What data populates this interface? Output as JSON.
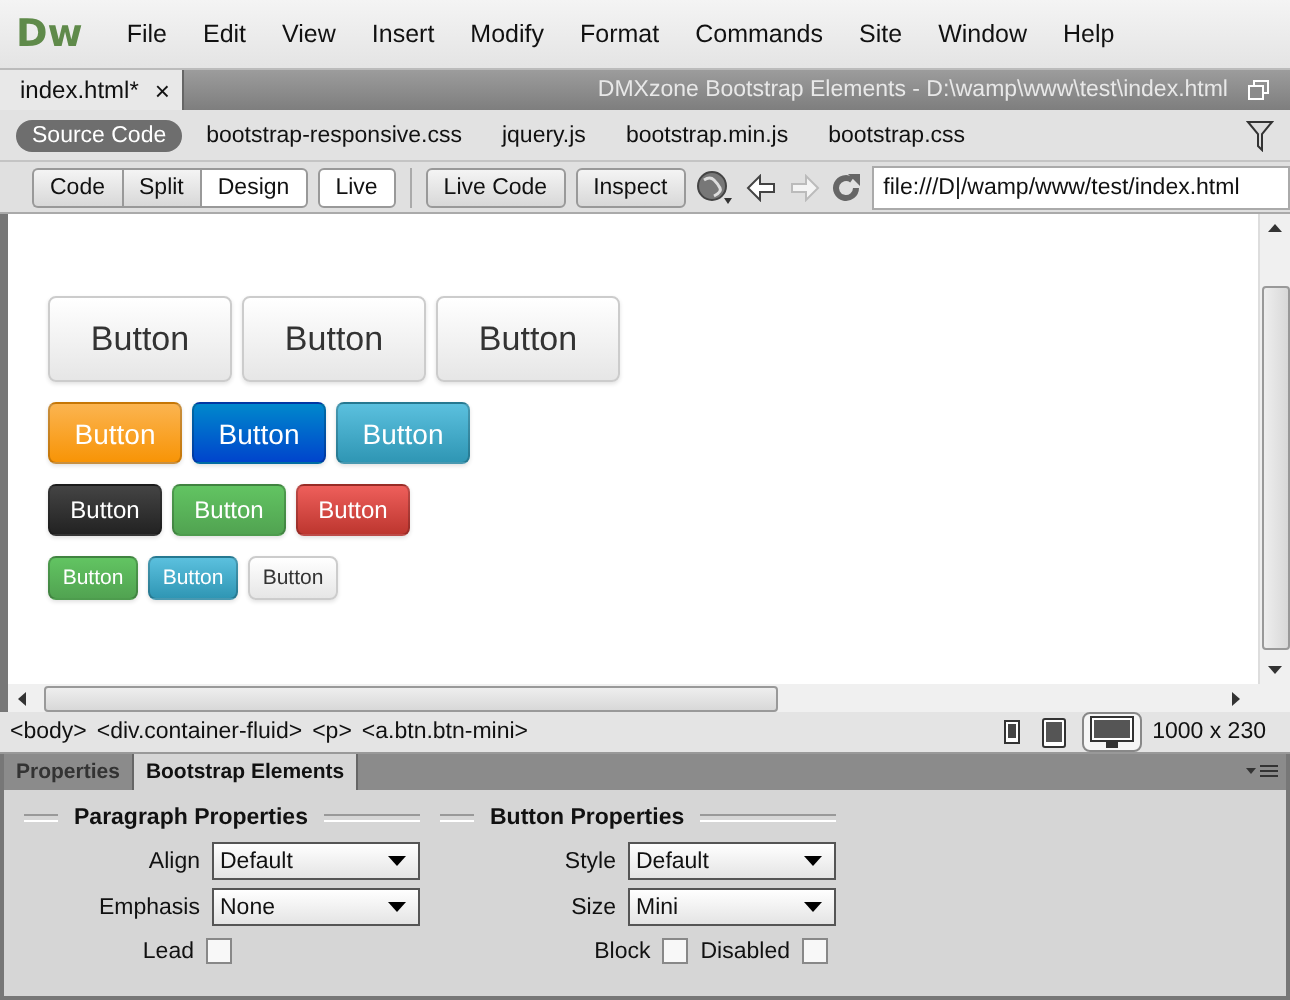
{
  "app": {
    "logo": "Dw"
  },
  "menu": [
    "File",
    "Edit",
    "View",
    "Insert",
    "Modify",
    "Format",
    "Commands",
    "Site",
    "Window",
    "Help"
  ],
  "document_tab": {
    "label": "index.html*",
    "close": "×"
  },
  "window_title": "DMXzone Bootstrap Elements - D:\\wamp\\www\\test\\index.html",
  "related_files": [
    {
      "label": "Source Code",
      "selected": true
    },
    {
      "label": "bootstrap-responsive.css",
      "selected": false
    },
    {
      "label": "jquery.js",
      "selected": false
    },
    {
      "label": "bootstrap.min.js",
      "selected": false
    },
    {
      "label": "bootstrap.css",
      "selected": false
    }
  ],
  "view_modes": [
    {
      "label": "Code",
      "selected": false
    },
    {
      "label": "Split",
      "selected": false
    },
    {
      "label": "Design",
      "selected": true
    }
  ],
  "live_button": "Live",
  "toolbar_buttons": [
    "Live Code",
    "Inspect"
  ],
  "address": "file:///D|/wamp/www/test/index.html",
  "button_rows": [
    {
      "kind": "large",
      "buttons": [
        {
          "label": "Button",
          "kind": "default"
        },
        {
          "label": "Button",
          "kind": "default"
        },
        {
          "label": "Button",
          "kind": "default"
        }
      ]
    },
    {
      "kind": "normal",
      "buttons": [
        {
          "label": "Button",
          "kind": "warning"
        },
        {
          "label": "Button",
          "kind": "primary"
        },
        {
          "label": "Button",
          "kind": "info"
        }
      ]
    },
    {
      "kind": "small",
      "buttons": [
        {
          "label": "Button",
          "kind": "inverse"
        },
        {
          "label": "Button",
          "kind": "success"
        },
        {
          "label": "Button",
          "kind": "danger"
        }
      ]
    },
    {
      "kind": "mini",
      "buttons": [
        {
          "label": "Button",
          "kind": "success"
        },
        {
          "label": "Button",
          "kind": "info"
        },
        {
          "label": "Button",
          "kind": "default"
        }
      ]
    }
  ],
  "tag_selector": [
    "<body>",
    "<div.container-fluid>",
    "<p>",
    "<a.btn.btn-mini>"
  ],
  "devices": [
    {
      "kind": "phone",
      "selected": false
    },
    {
      "kind": "tablet",
      "selected": false
    },
    {
      "kind": "desktop",
      "selected": true
    }
  ],
  "window_size": "1000 x 230",
  "panel_tabs": [
    {
      "label": "Properties",
      "selected": false
    },
    {
      "label": "Bootstrap Elements",
      "selected": true
    }
  ],
  "sections": [
    {
      "title": "Paragraph Properties",
      "fields": [
        {
          "label": "Align",
          "kind": "select",
          "value": "Default"
        },
        {
          "label": "Emphasis",
          "kind": "select",
          "value": "None"
        },
        {
          "label": "Lead",
          "kind": "checkbox",
          "checked": false
        }
      ]
    },
    {
      "title": "Button Properties",
      "fields": [
        {
          "label": "Style",
          "kind": "select",
          "value": "Default"
        },
        {
          "label": "Size",
          "kind": "select",
          "value": "Mini"
        },
        {
          "label": "Block",
          "kind": "checkbox",
          "checked": false
        },
        {
          "label": "Disabled",
          "kind": "checkbox",
          "checked": false
        }
      ]
    }
  ]
}
